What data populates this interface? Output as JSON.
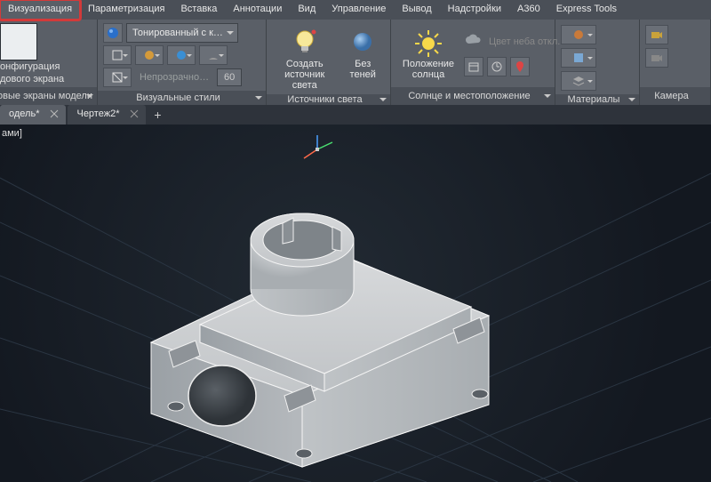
{
  "menu": {
    "items": [
      "Визуализация",
      "Параметризация",
      "Вставка",
      "Аннотации",
      "Вид",
      "Управление",
      "Вывод",
      "Надстройки",
      "A360",
      "Express Tools"
    ],
    "highlighted_index": 0
  },
  "ribbon": {
    "panels": [
      {
        "title_lines": [
          "онфигурация",
          "дового экрана"
        ],
        "footer": "овые экраны модели"
      },
      {
        "visual_style_combo": "Тонированный с к…",
        "opacity_label": "Непрозрачно…",
        "opacity_value": "60",
        "footer": "Визуальные стили"
      },
      {
        "create_light": "Создать\nисточник света",
        "no_shadows": "Без\nтеней",
        "footer": "Источники света"
      },
      {
        "sun_position": "Положение\nсолнца",
        "sky_off": "Цвет неба откл.",
        "footer": "Солнце и местоположение"
      },
      {
        "footer": "Материалы"
      },
      {
        "footer": "Камера"
      }
    ]
  },
  "tabs": {
    "items": [
      {
        "label": "одель*"
      },
      {
        "label": "Чертеж2*"
      }
    ]
  },
  "viewport": {
    "corner_text": "ами]"
  }
}
